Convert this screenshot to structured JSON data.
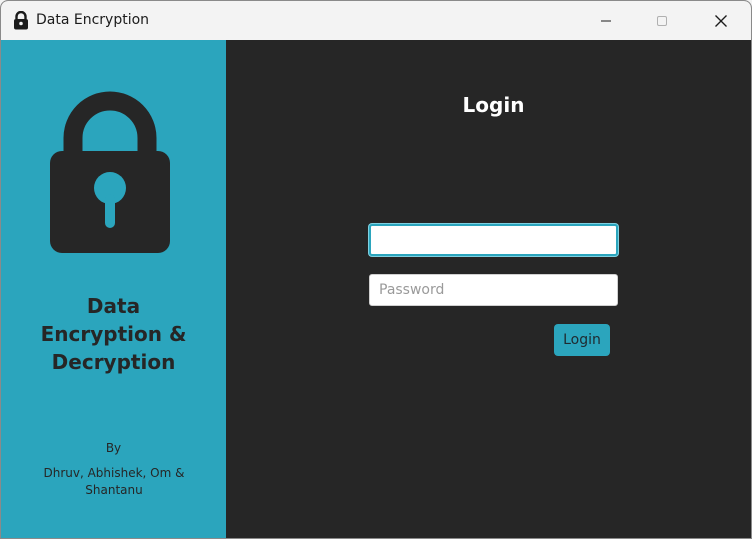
{
  "window": {
    "title": "Data Encryption",
    "icon": "lock-icon",
    "controls": [
      "minimize-icon",
      "maximize-icon",
      "close-icon"
    ]
  },
  "sidebar": {
    "logo_icon": "lock-icon",
    "heading_lines": [
      "Data",
      "Encryption &",
      "Decryption"
    ],
    "by_label": "By",
    "authors_lines": [
      "Dhruv, Abhishek, Om &",
      "Shantanu"
    ]
  },
  "login": {
    "title": "Login",
    "username_value": "",
    "username_placeholder": "",
    "password_value": "",
    "password_placeholder": "Password",
    "button_label": "Login"
  },
  "colors": {
    "accent": "#2ba5bd",
    "panel_dark": "#262626",
    "titlebar": "#f3f3f3",
    "text_dark": "#262626",
    "text_light": "#ffffff"
  }
}
